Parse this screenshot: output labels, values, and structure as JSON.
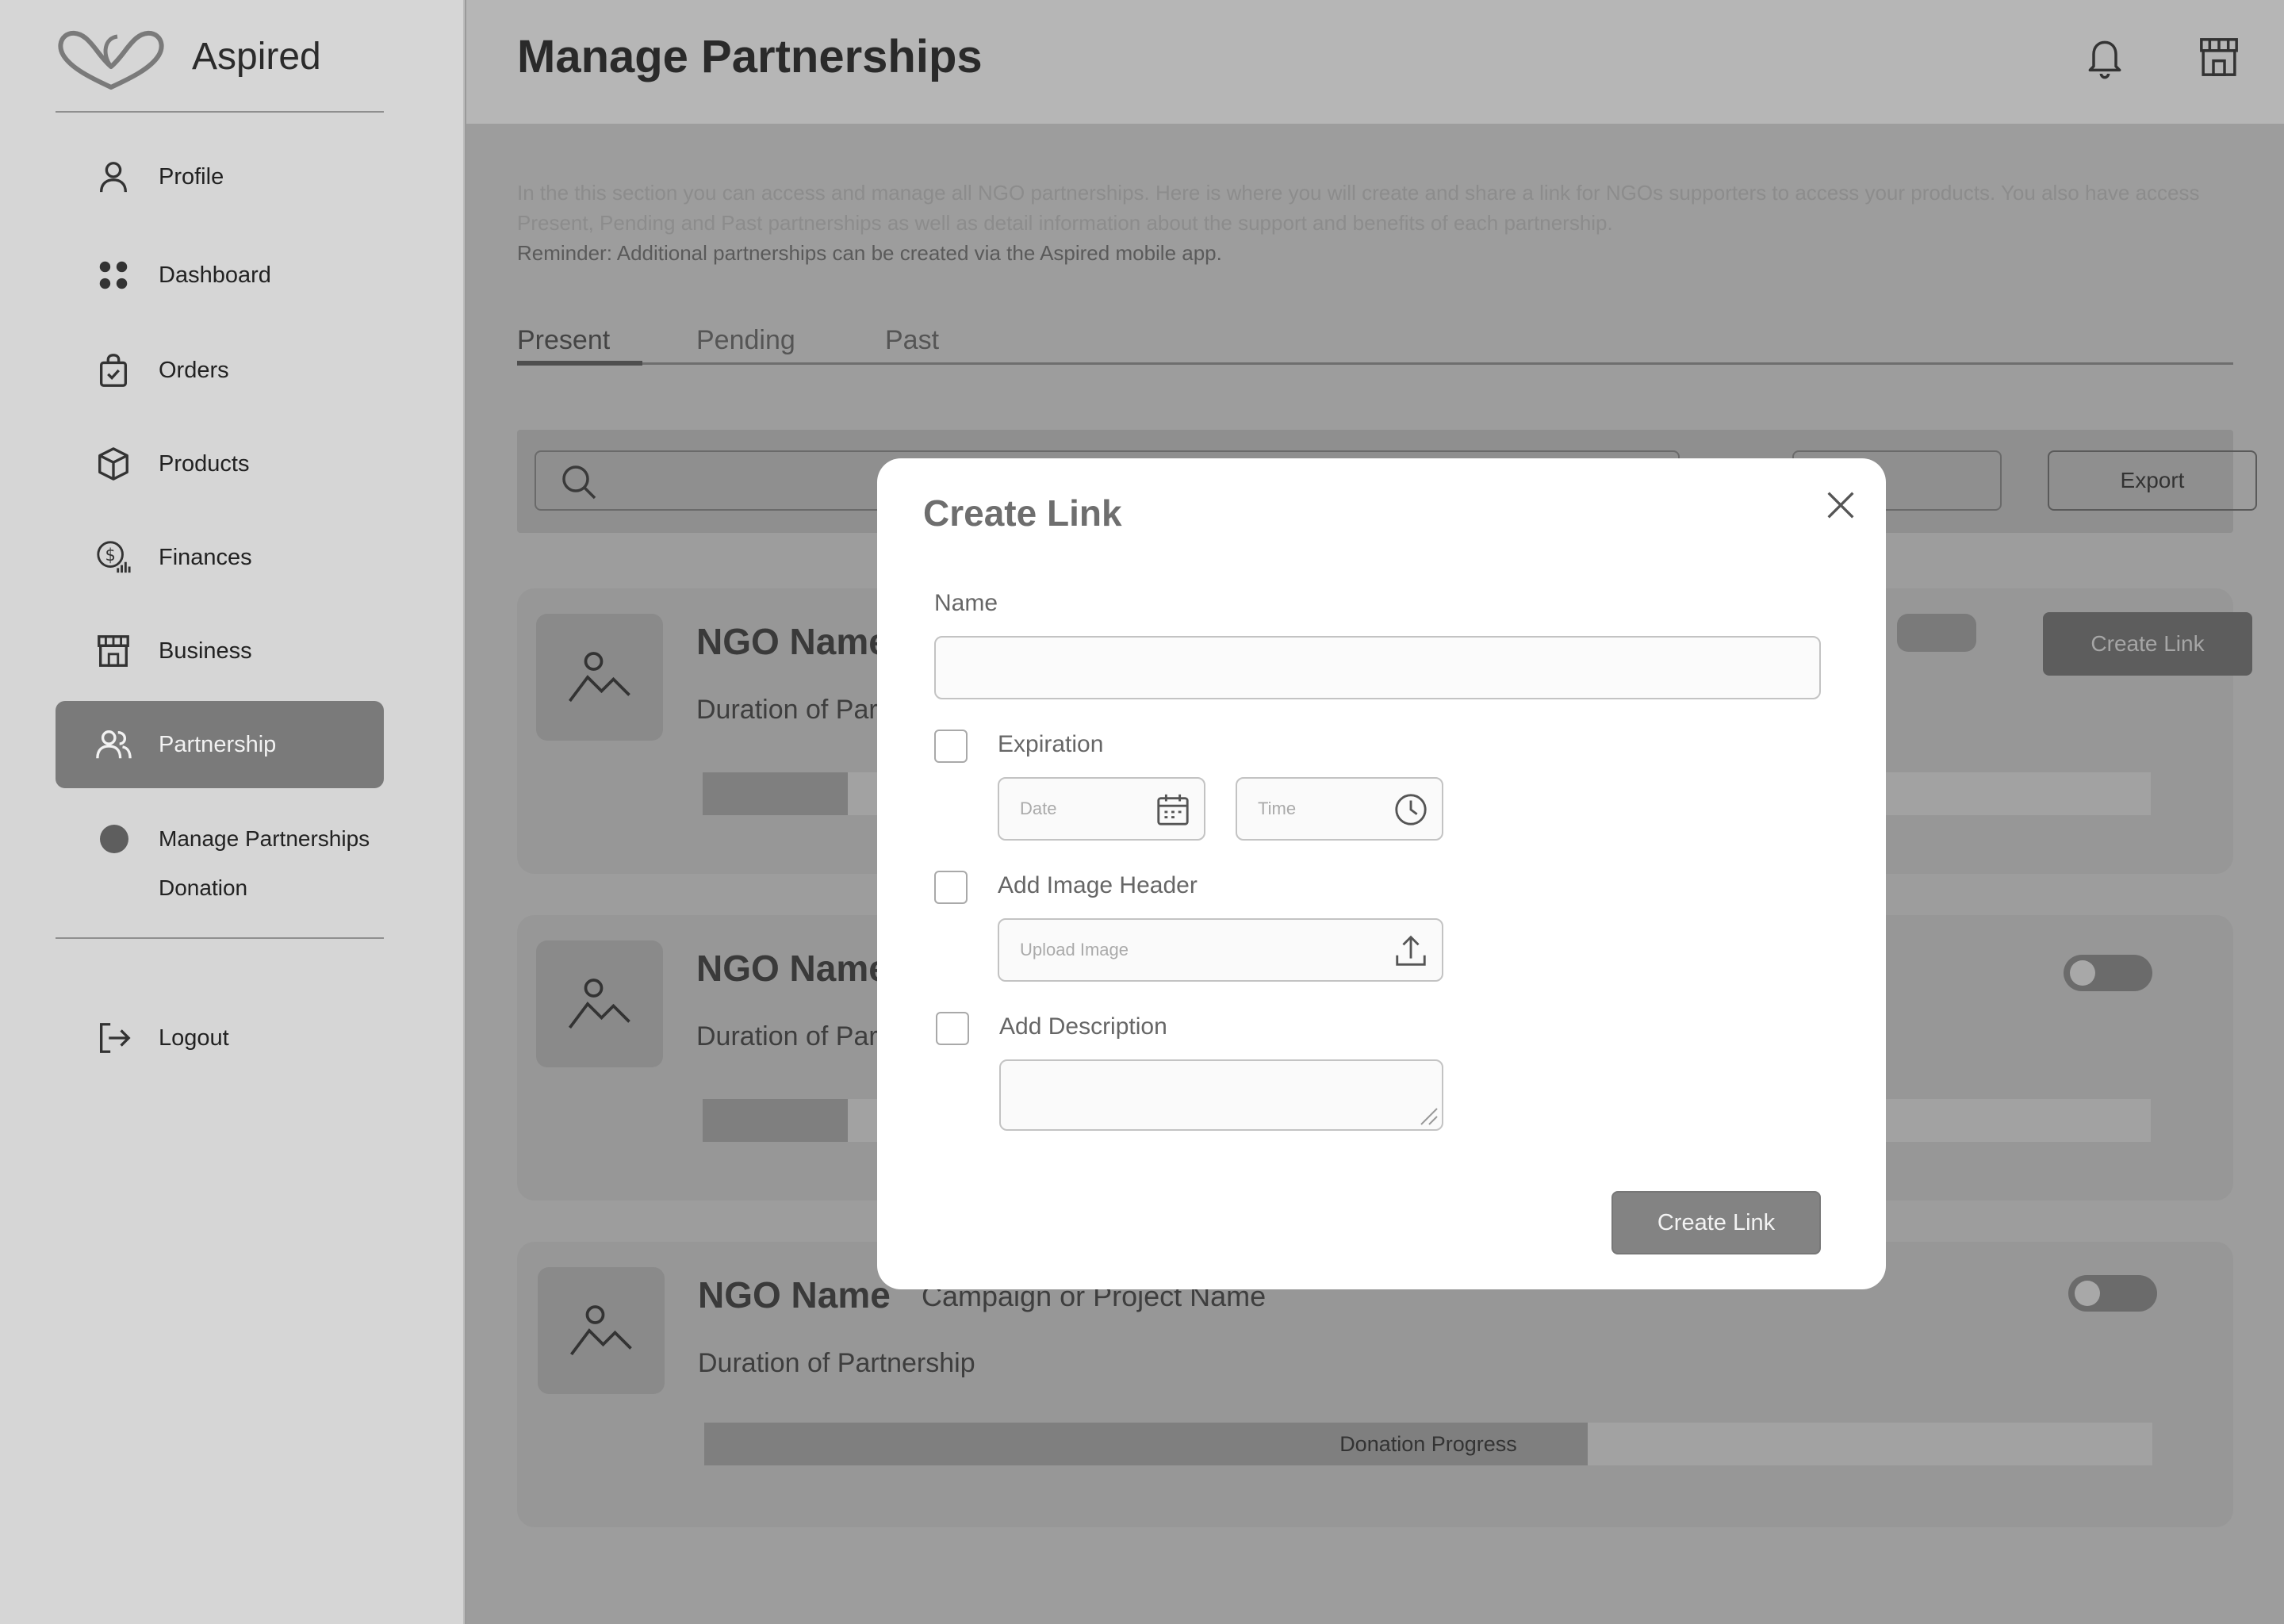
{
  "app": {
    "name": "Aspired"
  },
  "sidebar": {
    "items": [
      {
        "label": "Profile",
        "icon": "user-icon"
      },
      {
        "label": "Dashboard",
        "icon": "grid-icon"
      },
      {
        "label": "Orders",
        "icon": "shopping-bag-icon"
      },
      {
        "label": "Products",
        "icon": "box-icon"
      },
      {
        "label": "Finances",
        "icon": "finance-icon"
      },
      {
        "label": "Business",
        "icon": "store-icon"
      },
      {
        "label": "Partnership",
        "icon": "users-icon",
        "active": true
      }
    ],
    "subitems": [
      {
        "label": "Manage Partnerships",
        "active": true
      },
      {
        "label": "Donation"
      }
    ],
    "logout": {
      "label": "Logout",
      "icon": "logout-icon"
    }
  },
  "header": {
    "title": "Manage Partnerships",
    "icons": [
      "bell-icon",
      "store-icon"
    ]
  },
  "intro": {
    "line1": "In the  this section you can access and manage all NGO partnerships. Here is where you will create and share a link for NGOs supporters to access your products. You also have access",
    "line2": "Present, Pending and Past partnerships as well as detail information about the support and benefits of each partnership.",
    "reminder": "Reminder: Additional partnerships can be created via the Aspired mobile app."
  },
  "tabs": [
    {
      "label": "Present",
      "active": true
    },
    {
      "label": "Pending"
    },
    {
      "label": "Past"
    }
  ],
  "toolbar": {
    "export_label": "Export"
  },
  "cards": [
    {
      "ngo_name": "NGO Name",
      "duration": "Duration of Partnership",
      "button_label": "Create Link",
      "progress": 0.1
    },
    {
      "ngo_name": "NGO Name",
      "duration": "Duration of Partnership",
      "progress": 0.1
    },
    {
      "ngo_name": "NGO Name",
      "campaign": "Campaign or Project Name",
      "duration": "Duration of Partnership",
      "progress_label": "Donation Progress",
      "progress": 0.61
    }
  ],
  "modal": {
    "title": "Create Link",
    "name_label": "Name",
    "name_value": "",
    "expiration_label": "Expiration",
    "date_placeholder": "Date",
    "time_placeholder": "Time",
    "image_header_label": "Add Image Header",
    "upload_placeholder": "Upload Image",
    "description_label": "Add Description",
    "description_value": "",
    "submit_label": "Create Link"
  },
  "colors": {
    "sidebar_bg": "#d6d6d6",
    "active_nav": "#7a7a7a",
    "modal_bg": "#ffffff",
    "primary_button": "#838383"
  }
}
